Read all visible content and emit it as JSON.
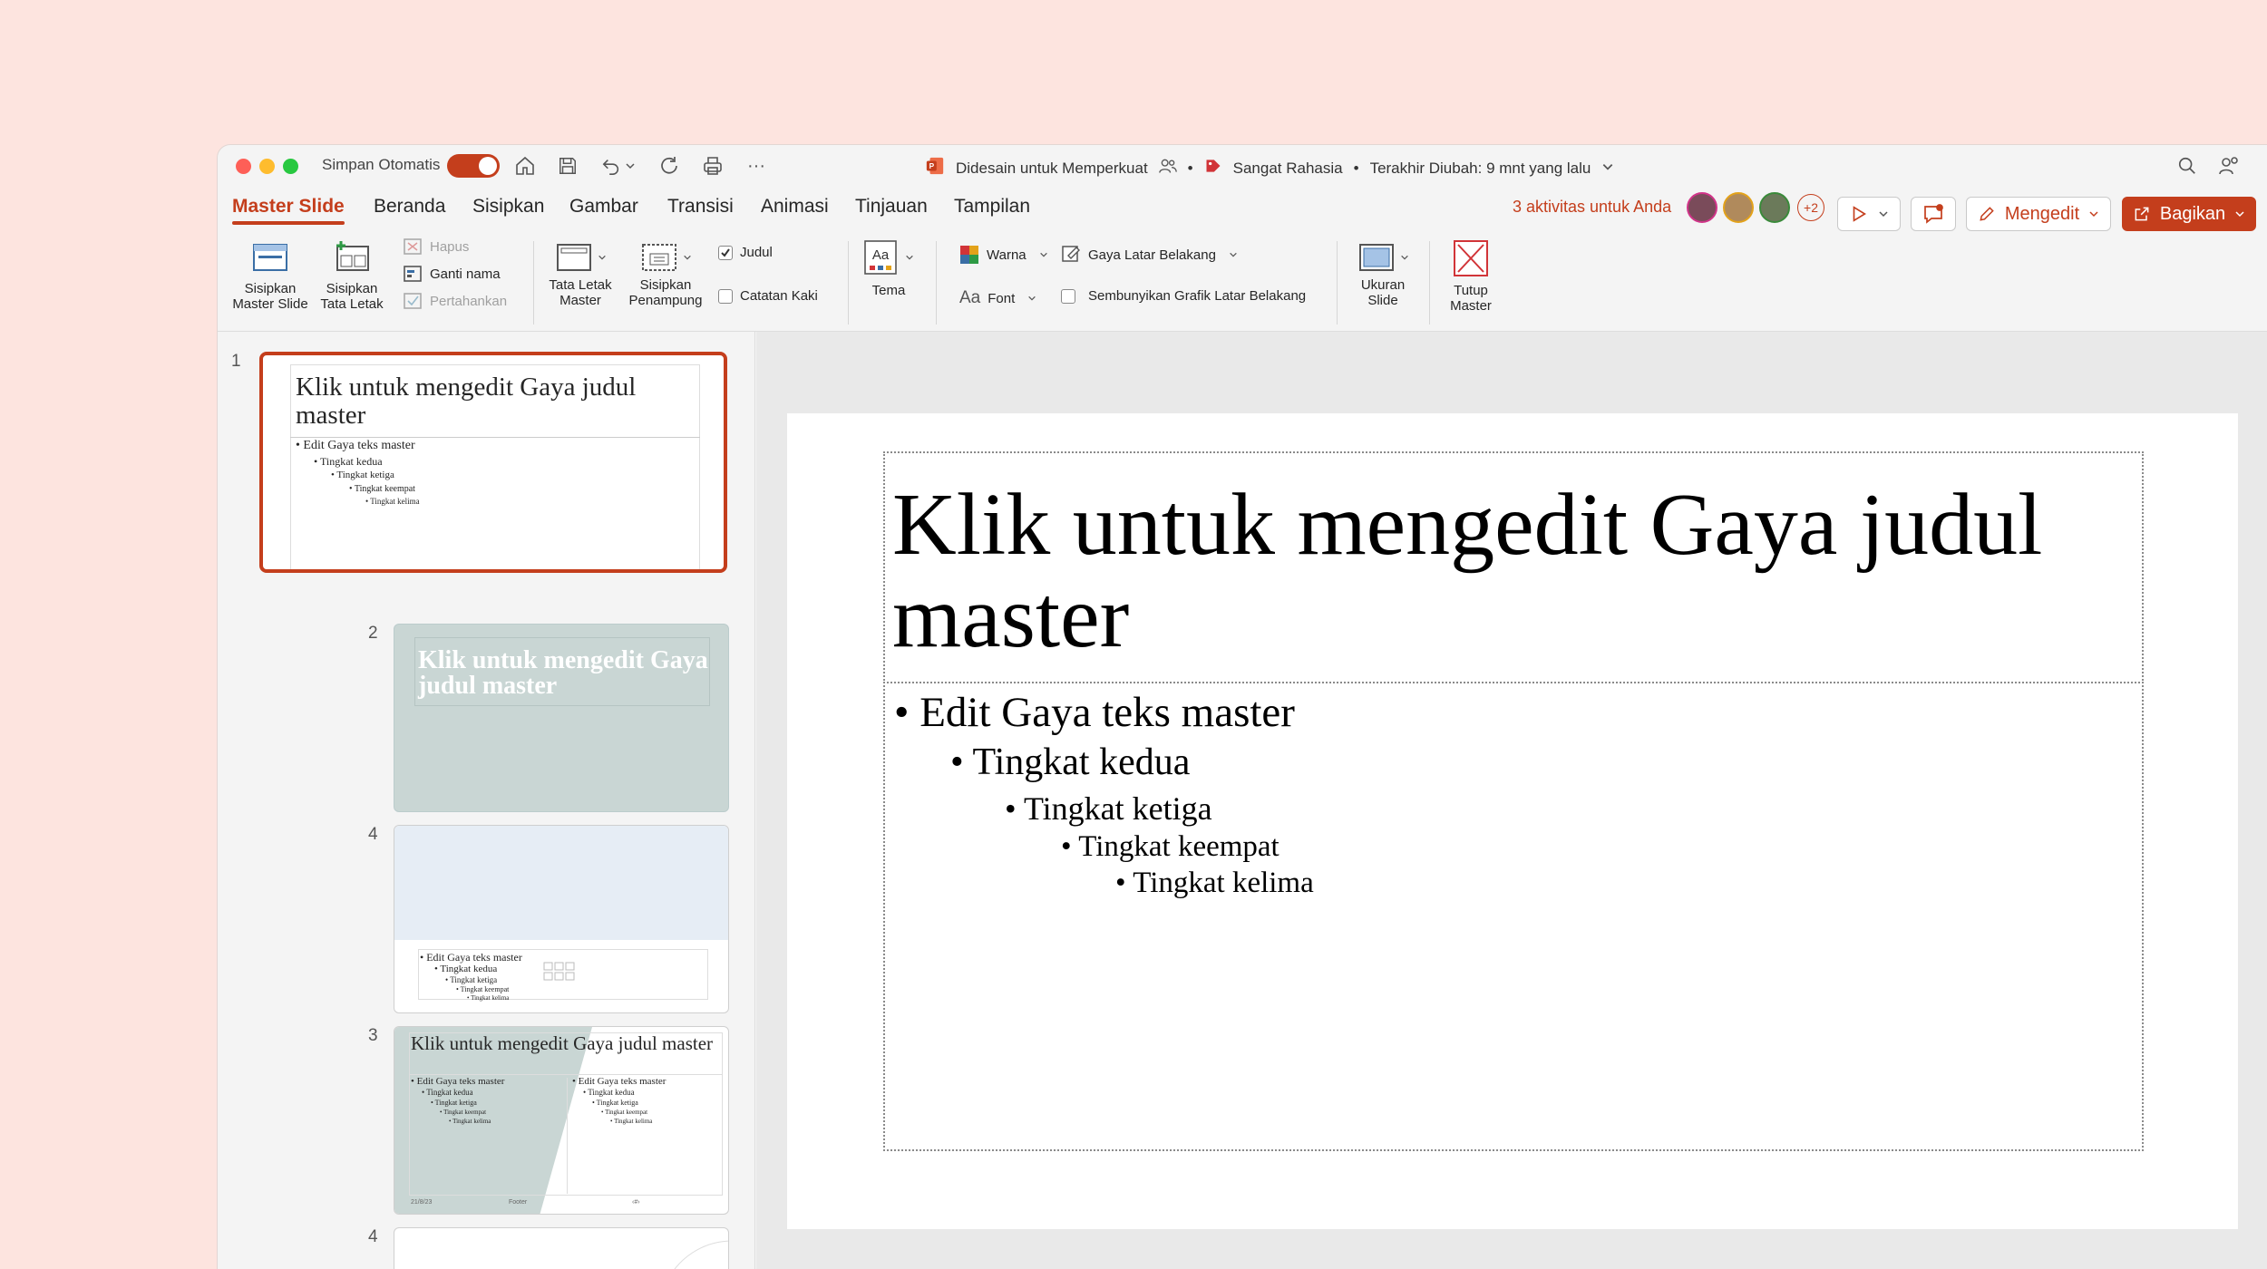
{
  "titlebar": {
    "autosave_label": "Simpan Otomatis",
    "doc_title": "Didesain untuk Memperkuat",
    "sensitivity": "Sangat Rahasia",
    "last_modified": "Terakhir Diubah: 9 mnt yang lalu",
    "bullet_sep": "•",
    "more": "···"
  },
  "tabs": [
    "Master Slide",
    "Beranda",
    "Sisipkan",
    "Gambar",
    "Transisi",
    "Animasi",
    "Tinjauan",
    "Tampilan"
  ],
  "right": {
    "activity": "3 aktivitas untuk Anda",
    "more_people": "+2",
    "edit_label": "Mengedit",
    "share_label": "Bagikan"
  },
  "ribbon": {
    "insert_master": [
      "Sisipkan",
      "Master Slide"
    ],
    "insert_layout": [
      "Sisipkan",
      "Tata Letak"
    ],
    "delete": "Hapus",
    "rename": "Ganti nama",
    "preserve": "Pertahankan",
    "master_layout": [
      "Tata Letak",
      "Master"
    ],
    "insert_placeholder": [
      "Sisipkan",
      "Penampung"
    ],
    "title_chk": "Judul",
    "footer_chk": "Catatan Kaki",
    "theme": "Tema",
    "colors": "Warna",
    "fonts": "Font",
    "font_glyph": "Aa",
    "bg_styles": "Gaya Latar Belakang",
    "hide_bg": "Sembunyikan Grafik Latar Belakang",
    "slide_size": [
      "Ukuran",
      "Slide"
    ],
    "close_master": [
      "Tutup",
      "Master"
    ]
  },
  "thumbs": {
    "numbers": [
      "1",
      "2",
      "4",
      "3",
      "4"
    ],
    "t1_title": "Klik untuk mengedit Gaya judul master",
    "t2_title": "Klik untuk mengedit Gaya judul master",
    "t3_title": "Klik untuk mengedit Gaya judul master",
    "levels": [
      "• Edit Gaya teks master",
      "• Tingkat kedua",
      "• Tingkat ketiga",
      "• Tingkat keempat",
      "• Tingkat kelima"
    ],
    "date": "21/8/23",
    "footer": "Footer",
    "page": "‹#›"
  },
  "slide": {
    "title": "Klik untuk mengedit Gaya judul master",
    "levels": [
      "• Edit Gaya teks master",
      "• Tingkat kedua",
      "• Tingkat ketiga",
      "• Tingkat keempat",
      "• Tingkat kelima"
    ]
  },
  "colors": {
    "accent": "#c43e1c",
    "traffic_red": "#fe5f57",
    "traffic_yellow": "#febc2e",
    "traffic_green": "#28c840"
  }
}
